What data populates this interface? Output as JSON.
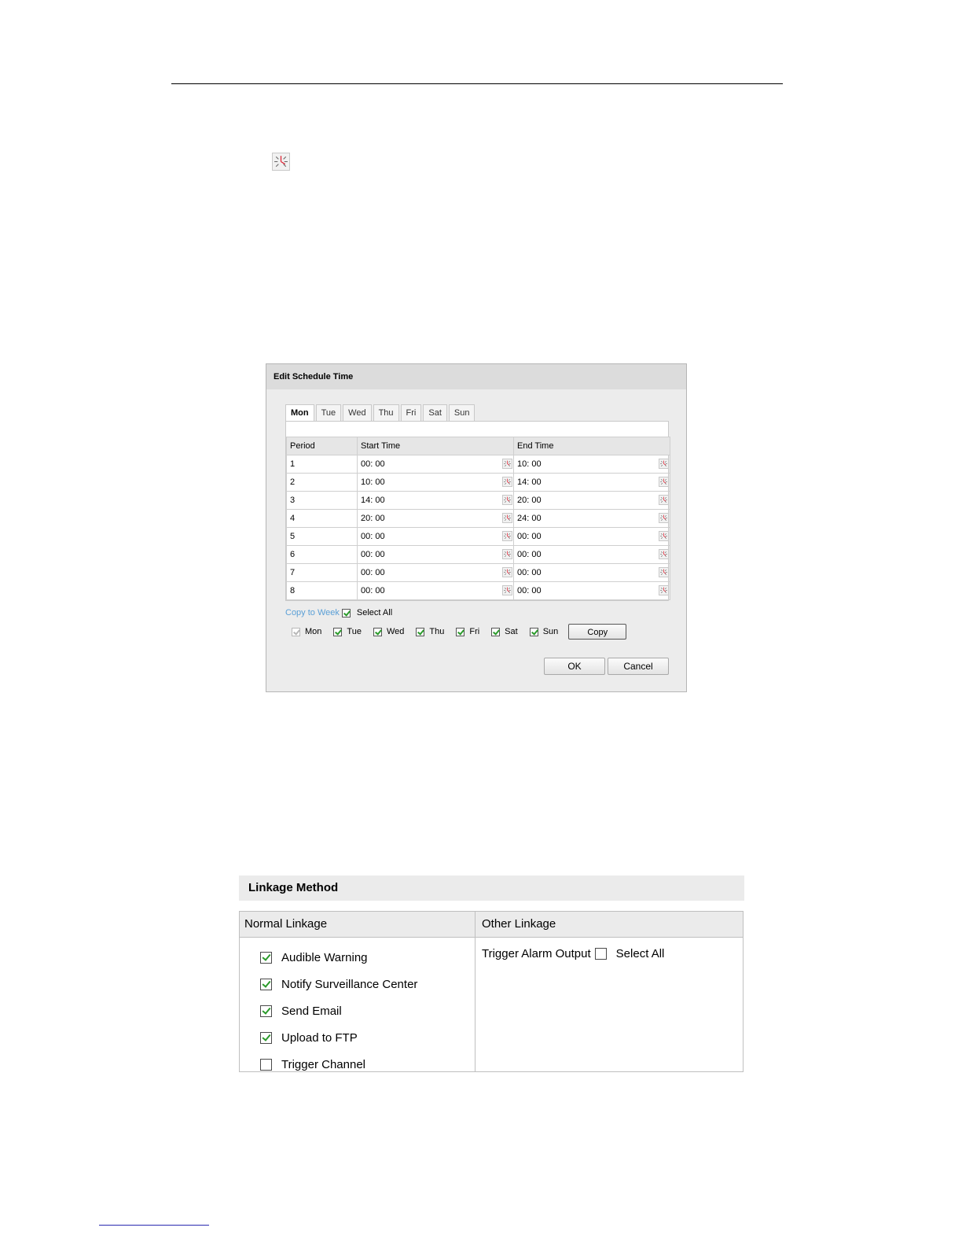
{
  "dialog": {
    "title": "Edit Schedule Time",
    "tabs": [
      "Mon",
      "Tue",
      "Wed",
      "Thu",
      "Fri",
      "Sat",
      "Sun"
    ],
    "active_tab": "Mon",
    "columns": [
      "Period",
      "Start Time",
      "End Time"
    ],
    "rows": [
      {
        "period": "1",
        "start": "00: 00",
        "end": "10: 00"
      },
      {
        "period": "2",
        "start": "10: 00",
        "end": "14: 00"
      },
      {
        "period": "3",
        "start": "14: 00",
        "end": "20: 00"
      },
      {
        "period": "4",
        "start": "20: 00",
        "end": "24: 00"
      },
      {
        "period": "5",
        "start": "00: 00",
        "end": "00: 00"
      },
      {
        "period": "6",
        "start": "00: 00",
        "end": "00: 00"
      },
      {
        "period": "7",
        "start": "00: 00",
        "end": "00: 00"
      },
      {
        "period": "8",
        "start": "00: 00",
        "end": "00: 00"
      }
    ],
    "copy_to_week": "Copy to Week",
    "select_all": "Select All",
    "select_all_checked": true,
    "days": [
      {
        "label": "Mon",
        "checked": true,
        "disabled": true
      },
      {
        "label": "Tue",
        "checked": true,
        "disabled": false
      },
      {
        "label": "Wed",
        "checked": true,
        "disabled": false
      },
      {
        "label": "Thu",
        "checked": true,
        "disabled": false
      },
      {
        "label": "Fri",
        "checked": true,
        "disabled": false
      },
      {
        "label": "Sat",
        "checked": true,
        "disabled": false
      },
      {
        "label": "Sun",
        "checked": true,
        "disabled": false
      }
    ],
    "copy_label": "Copy",
    "ok_label": "OK",
    "cancel_label": "Cancel"
  },
  "linkage": {
    "title": "Linkage Method",
    "normal_header": "Normal Linkage",
    "other_header": "Other Linkage",
    "normal_items": [
      {
        "label": "Audible Warning",
        "checked": true
      },
      {
        "label": "Notify Surveillance Center",
        "checked": true
      },
      {
        "label": "Send Email",
        "checked": true
      },
      {
        "label": "Upload to FTP",
        "checked": true
      },
      {
        "label": "Trigger Channel",
        "checked": false
      }
    ],
    "trigger_alarm_output": "Trigger Alarm Output",
    "other_select_all": "Select All",
    "other_select_all_checked": false
  },
  "icons": {
    "clock": "clock-icon"
  },
  "colors": {
    "link": "#5a9fd6",
    "check": "#2a9a2a"
  }
}
